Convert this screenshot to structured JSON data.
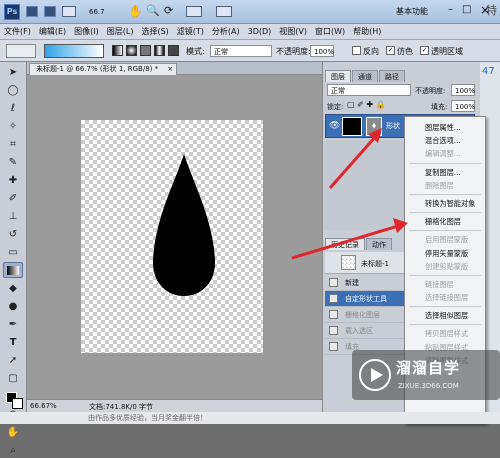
{
  "titlebar": {
    "app_icon": "Ps",
    "zoom": "66.7",
    "workspace": "基本功能",
    "min": "–",
    "max": "□",
    "close": "×"
  },
  "menu": [
    "文件(F)",
    "编辑(E)",
    "图像(I)",
    "图层(L)",
    "选择(S)",
    "滤镜(T)",
    "分析(A)",
    "3D(D)",
    "视图(V)",
    "窗口(W)",
    "帮助(H)"
  ],
  "options": {
    "mode_label": "模式:",
    "mode_value": "正常",
    "opacity_label": "不透明度:",
    "opacity_value": "100%",
    "reverse": "反向",
    "dither": "仿色",
    "transparency": "透明区域"
  },
  "document": {
    "tab": "未标题-1 @ 66.7% (形状 1, RGB/8) *",
    "close": "×"
  },
  "status": {
    "zoom": "66.67%",
    "doc": "文档:741.8K/0 字节"
  },
  "layers_panel": {
    "tabs": [
      "图层",
      "通道",
      "路径"
    ],
    "blend": "正常",
    "opacity_label": "不透明度:",
    "opacity_value": "100%",
    "lock_label": "锁定:",
    "fill_label": "填充:",
    "fill_value": "100%",
    "layer_name": "形状"
  },
  "history_panel": {
    "tabs": [
      "历史记录",
      "动作"
    ],
    "snapshot": "未标题-1",
    "rows": [
      "新建",
      "自定形状工具",
      "栅格化图层",
      "载入选区",
      "填充"
    ]
  },
  "context_menu": {
    "items": [
      {
        "label": "图层属性...",
        "enabled": true
      },
      {
        "label": "混合选项...",
        "enabled": true
      },
      {
        "label": "编辑调整...",
        "enabled": false
      },
      {
        "sep": true
      },
      {
        "label": "复制图层...",
        "enabled": true
      },
      {
        "label": "删除图层",
        "enabled": false
      },
      {
        "sep": true
      },
      {
        "label": "转换为智能对象",
        "enabled": true
      },
      {
        "sep": true
      },
      {
        "label": "栅格化图层",
        "enabled": true
      },
      {
        "sep": true
      },
      {
        "label": "启用图层蒙版",
        "enabled": false
      },
      {
        "label": "停用矢量蒙版",
        "enabled": true
      },
      {
        "label": "创建剪贴蒙版",
        "enabled": false
      },
      {
        "sep": true
      },
      {
        "label": "链接图层",
        "enabled": false
      },
      {
        "label": "选择链接图层",
        "enabled": false
      },
      {
        "sep": true
      },
      {
        "label": "选择相似图层",
        "enabled": true
      },
      {
        "sep": true
      },
      {
        "label": "拷贝图层样式",
        "enabled": false
      },
      {
        "label": "粘贴图层样式",
        "enabled": false
      },
      {
        "label": "清除图层样式",
        "enabled": false
      }
    ]
  },
  "watermark": {
    "brand": "溜溜自学",
    "url": "ZIXUE.3D66.COM"
  },
  "edge_text": {
    "corner": "特",
    "num": "47",
    "bottom_text": "由作品多优质经验，当月奖金翻半倍！"
  },
  "colors": {
    "title_bg": "#b4c9e4",
    "arrow": "#e0262a",
    "selection": "#3b6fb6"
  }
}
